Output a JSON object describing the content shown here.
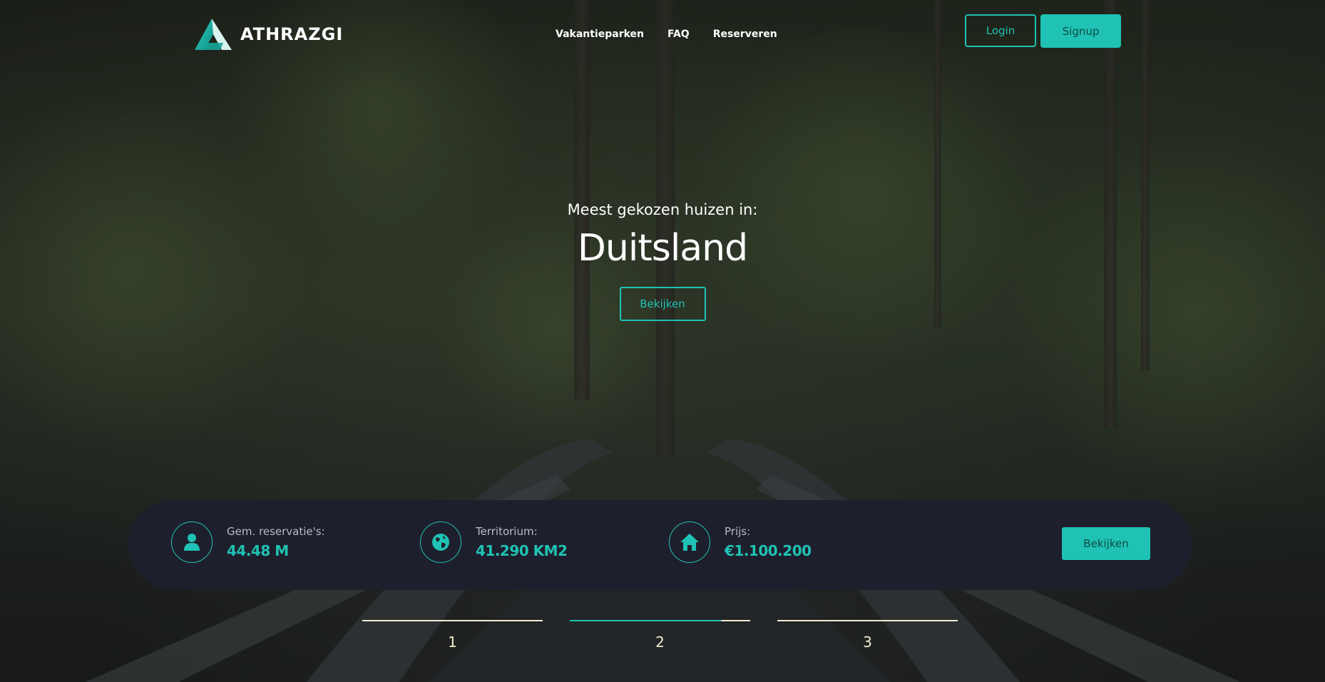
{
  "brand": {
    "name": "ATHRAZGI"
  },
  "nav": {
    "items": [
      "Vakantieparken",
      "FAQ",
      "Reserveren"
    ]
  },
  "auth": {
    "login": "Login",
    "signup": "Signup"
  },
  "hero": {
    "subtitle": "Meest gekozen huizen in:",
    "title": "Duitsland",
    "button": "Bekijken"
  },
  "info": {
    "stats": [
      {
        "icon": "user-icon",
        "label": "Gem. reservatie's:",
        "value": "44.48 M"
      },
      {
        "icon": "globe-icon",
        "label": "Territorium:",
        "value": "41.290 KM2"
      },
      {
        "icon": "home-icon",
        "label": "Prijs:",
        "value": "€1.100.200"
      }
    ],
    "button": "Bekijken"
  },
  "pager": {
    "items": [
      "1",
      "2",
      "3"
    ],
    "active_index": 1,
    "active_progress": 0.84
  },
  "colors": {
    "accent": "#1fc2b4",
    "bar": "#1e1f2c",
    "pager": "#f2eccf"
  }
}
